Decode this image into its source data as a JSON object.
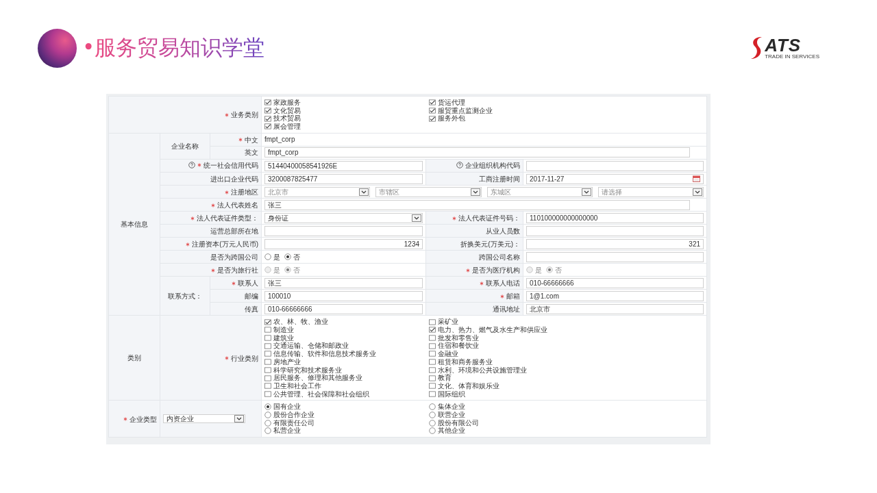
{
  "header": {
    "title": "•服务贸易知识学堂",
    "logo": {
      "name": "ATS",
      "tagline": "TRADE IN SERVICES"
    }
  },
  "form": {
    "business_types": {
      "label": "业务类别",
      "required": true,
      "options": [
        {
          "label": "家政服务",
          "checked": true
        },
        {
          "label": "货运代理",
          "checked": true
        },
        {
          "label": "文化贸易",
          "checked": true
        },
        {
          "label": "服贸重点监测企业",
          "checked": true
        },
        {
          "label": "技术贸易",
          "checked": true
        },
        {
          "label": "服务外包",
          "checked": true
        },
        {
          "label": "展会管理",
          "checked": true
        }
      ]
    },
    "basic_info": {
      "label": "基本信息",
      "sections": [
        {
          "kind": "group",
          "label": "企业名称",
          "rows": [
            {
              "label": "中文",
              "required": true,
              "field": {
                "kind": "text",
                "value": "fmpt_corp"
              }
            },
            {
              "label": "英文",
              "field": {
                "kind": "input",
                "value": "fmpt_corp"
              }
            }
          ]
        },
        {
          "kind": "row",
          "label": "统一社会信用代码",
          "required": true,
          "help": true,
          "field": {
            "kind": "input",
            "value": "51440400058541926E"
          },
          "right": {
            "label": "企业组织机构代码",
            "help": true,
            "field": {
              "kind": "input"
            }
          }
        },
        {
          "kind": "row",
          "label": "进出口企业代码",
          "field": {
            "kind": "input",
            "value": "3200087825477"
          },
          "right": {
            "label": "工商注册时间",
            "field": {
              "kind": "date",
              "value": "2017-11-27"
            }
          }
        },
        {
          "kind": "row",
          "label": "注册地区",
          "required": true,
          "field": {
            "kind": "region",
            "selects": [
              {
                "value": "北京市"
              },
              {
                "value": "市辖区"
              },
              {
                "value": "东城区"
              },
              {
                "value": "请选择"
              }
            ]
          }
        },
        {
          "kind": "row",
          "label": "法人代表姓名",
          "required": true,
          "field": {
            "kind": "input",
            "value": "张三"
          }
        },
        {
          "kind": "row",
          "label": "法人代表证件类型：",
          "required": true,
          "field": {
            "kind": "select",
            "value": "身份证"
          },
          "right": {
            "label": "法人代表证件号码：",
            "required": true,
            "field": {
              "kind": "input",
              "value": "110100000000000000"
            }
          }
        },
        {
          "kind": "row",
          "label": "运营总部所在地",
          "field": {
            "kind": "input"
          },
          "right": {
            "label": "从业人员数",
            "field": {
              "kind": "input"
            }
          }
        },
        {
          "kind": "row",
          "label": "注册资本(万元人民币)",
          "required": true,
          "field": {
            "kind": "number",
            "value": "1234"
          },
          "right": {
            "label": "折换美元(万美元)：",
            "field": {
              "kind": "number",
              "value": "321"
            }
          }
        },
        {
          "kind": "row",
          "label": "是否为跨国公司",
          "field": {
            "kind": "radio",
            "disabled": false,
            "options": [
              {
                "label": "是",
                "selected": false
              },
              {
                "label": "否",
                "selected": true
              }
            ]
          },
          "right": {
            "label": "跨国公司名称",
            "field": {
              "kind": "input"
            }
          }
        },
        {
          "kind": "row",
          "label": "是否为旅行社",
          "required": true,
          "field": {
            "kind": "radio",
            "disabled": true,
            "options": [
              {
                "label": "是",
                "selected": false
              },
              {
                "label": "否",
                "selected": true
              }
            ]
          },
          "right": {
            "label": "是否为医疗机构",
            "required": true,
            "field": {
              "kind": "radio",
              "disabled": true,
              "options": [
                {
                  "label": "是",
                  "selected": false
                },
                {
                  "label": "否",
                  "selected": true
                }
              ]
            }
          }
        },
        {
          "kind": "group",
          "label": "联系方式：",
          "rows": [
            {
              "label": "联系人",
              "required": true,
              "field": {
                "kind": "input",
                "value": "张三"
              },
              "right": {
                "label": "联系人电话",
                "required": true,
                "field": {
                  "kind": "input",
                  "value": "010-66666666"
                }
              }
            },
            {
              "label": "邮编",
              "field": {
                "kind": "input",
                "value": "100010"
              },
              "right": {
                "label": "邮箱",
                "required": true,
                "field": {
                  "kind": "input",
                  "value": "1@1.com"
                }
              }
            },
            {
              "label": "传真",
              "field": {
                "kind": "input",
                "value": "010-66666666"
              },
              "right": {
                "label": "通讯地址",
                "field": {
                  "kind": "input",
                  "value": "北京市"
                }
              }
            }
          ]
        }
      ]
    },
    "category": {
      "label": "类别",
      "industry": {
        "label": "行业类别",
        "required": true,
        "options": [
          {
            "label": "农、林、牧、渔业",
            "checked": true
          },
          {
            "label": "采矿业",
            "checked": false
          },
          {
            "label": "制造业",
            "checked": false
          },
          {
            "label": "电力、热力、燃气及水生产和供应业",
            "checked": true
          },
          {
            "label": "建筑业",
            "checked": false
          },
          {
            "label": "批发和零售业",
            "checked": false
          },
          {
            "label": "交通运输、仓储和邮政业",
            "checked": false
          },
          {
            "label": "住宿和餐饮业",
            "checked": false
          },
          {
            "label": "信息传输、软件和信息技术服务业",
            "checked": false
          },
          {
            "label": "金融业",
            "checked": false
          },
          {
            "label": "房地产业",
            "checked": false
          },
          {
            "label": "租赁和商务服务业",
            "checked": false
          },
          {
            "label": "科学研究和技术服务业",
            "checked": false
          },
          {
            "label": "水利、环境和公共设施管理业",
            "checked": false
          },
          {
            "label": "居民服务、修理和其他服务业",
            "checked": false
          },
          {
            "label": "教育",
            "checked": false
          },
          {
            "label": "卫生和社会工作",
            "checked": false
          },
          {
            "label": "文化、体育和娱乐业",
            "checked": false
          },
          {
            "label": "公共管理、社会保障和社会组织",
            "checked": false
          },
          {
            "label": "国际组织",
            "checked": false
          }
        ]
      }
    },
    "enterprise_type": {
      "label": "企业类型",
      "required": true,
      "select": {
        "value": "内资企业"
      },
      "options": [
        {
          "label": "国有企业",
          "selected": true
        },
        {
          "label": "集体企业",
          "selected": false
        },
        {
          "label": "股份合作企业",
          "selected": false
        },
        {
          "label": "联营企业",
          "selected": false
        },
        {
          "label": "有限责任公司",
          "selected": false
        },
        {
          "label": "股份有限公司",
          "selected": false
        },
        {
          "label": "私营企业",
          "selected": false
        },
        {
          "label": "其他企业",
          "selected": false
        }
      ]
    }
  }
}
